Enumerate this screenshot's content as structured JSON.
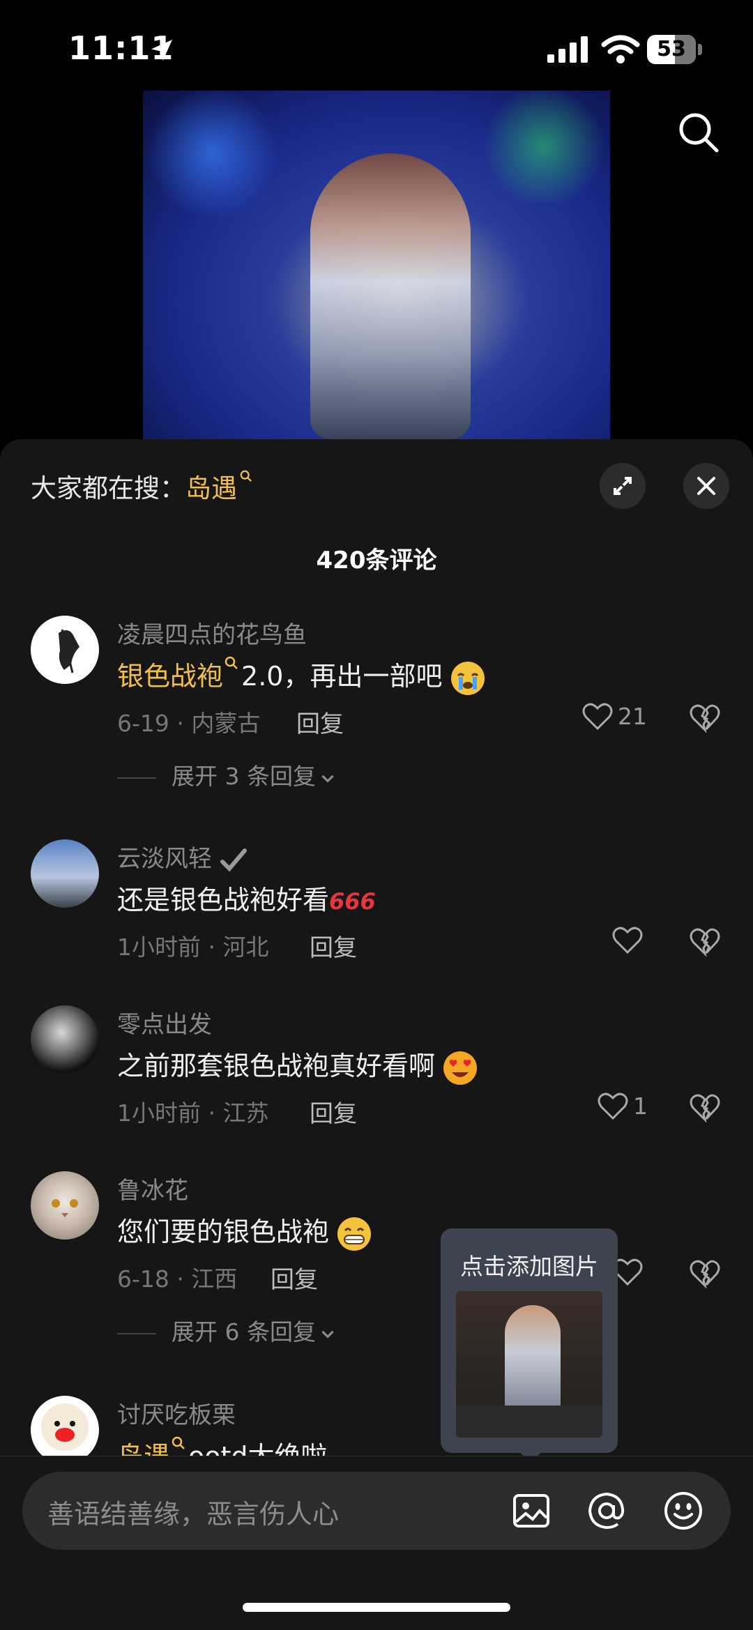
{
  "status_bar": {
    "time": "11:11",
    "battery": "53"
  },
  "panel": {
    "trending_prefix": "大家都在搜：",
    "trending_term": "岛遇",
    "comment_count": "420条评论"
  },
  "comments": [
    {
      "name": "凌晨四点的花鸟鱼",
      "text_highlight": "银色战袍",
      "text": "2.0，再出一部吧",
      "date": "6-19",
      "location": "内蒙古",
      "reply_label": "回复",
      "likes": "21",
      "expand": "展开 3 条回复"
    },
    {
      "name": "云淡风轻",
      "text": "还是银色战袍好看",
      "text_suffix": "666",
      "date": "1小时前",
      "location": "河北",
      "reply_label": "回复",
      "likes": ""
    },
    {
      "name": "零点出发",
      "text": "之前那套银色战袍真好看啊",
      "date": "1小时前",
      "location": "江苏",
      "reply_label": "回复",
      "likes": "1"
    },
    {
      "name": "鲁冰花",
      "text": "您们要的银色战袍",
      "date": "6-18",
      "location": "江西",
      "reply_label": "回复",
      "likes": "",
      "expand": "展开 6 条回复"
    },
    {
      "name": "讨厌吃板栗",
      "text_highlight": "岛遇",
      "text": "ootd太绝啦"
    }
  ],
  "tooltip": {
    "text": "点击添加图片"
  },
  "input": {
    "placeholder": "善语结善缘，恶言伤人心"
  },
  "colors": {
    "accent": "#f2c04a",
    "panel_bg": "#161616"
  }
}
